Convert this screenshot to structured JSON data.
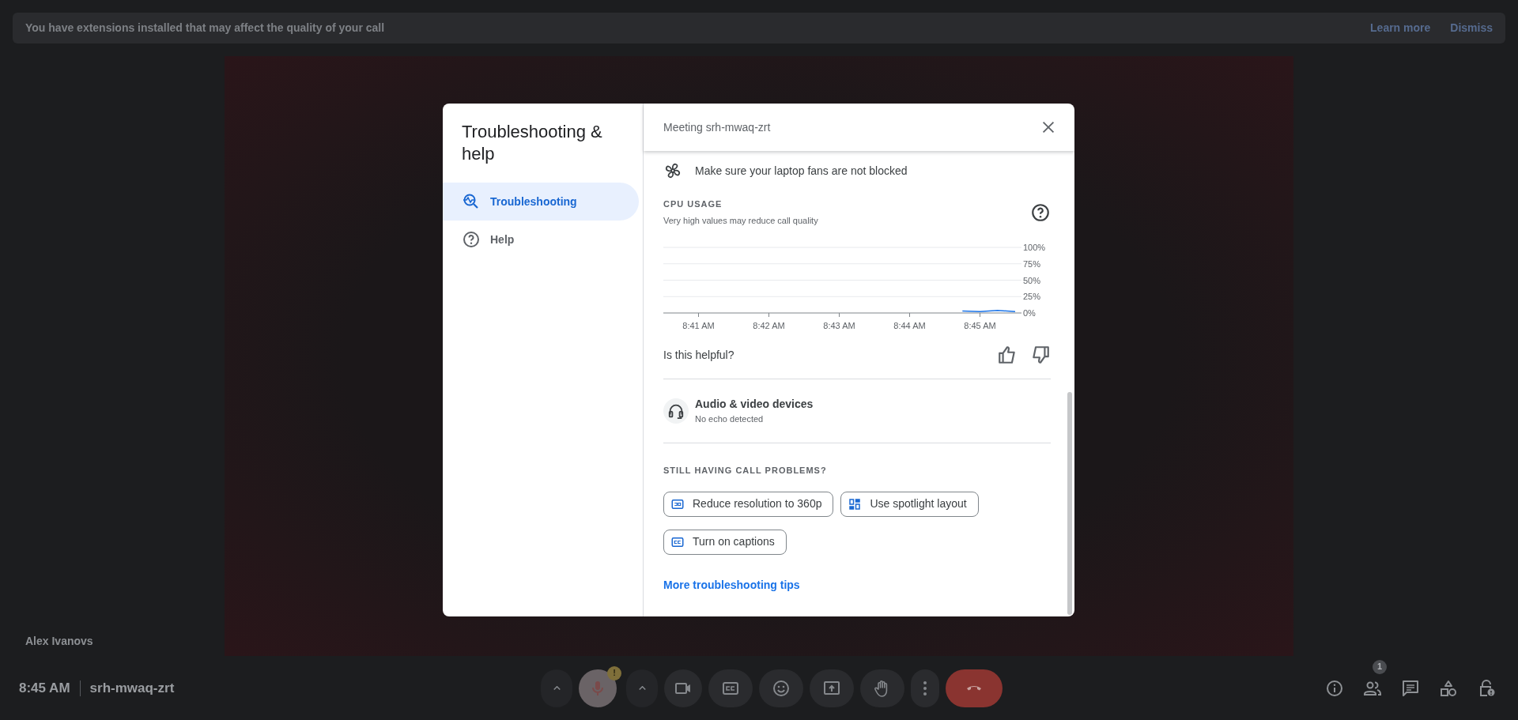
{
  "banner": {
    "text": "You have extensions installed that may affect the quality of your call",
    "links": [
      "Learn more",
      "Dismiss"
    ]
  },
  "tile": {
    "participant_name": "Alex Ivanovs"
  },
  "dialog": {
    "title": "Troubleshooting & help",
    "nav": [
      {
        "label": "Troubleshooting",
        "kind": "troubleshoot",
        "selected": true
      },
      {
        "label": "Help",
        "kind": "help",
        "selected": false
      }
    ],
    "header": {
      "meeting": "Meeting srh-mwaq-zrt"
    },
    "tip": {
      "text": "Make sure your laptop fans are not blocked"
    },
    "cpu": {
      "title": "CPU USAGE",
      "subtitle": "Very high values may reduce call quality",
      "chart_data": {
        "type": "line",
        "grid": true,
        "ylim": [
          0,
          100
        ],
        "categories": [
          null,
          null,
          "8:41 AM",
          null,
          null,
          null,
          "8:42 AM",
          null,
          null,
          null,
          "8:43 AM",
          null,
          null,
          null,
          "8:44 AM",
          null,
          null,
          null,
          "8:45 AM",
          null,
          null
        ],
        "yticks": [
          {
            "value": 0,
            "label": "0%"
          },
          {
            "value": 25,
            "label": "25%"
          },
          {
            "value": 50,
            "label": "50%"
          },
          {
            "value": 75,
            "label": "75%"
          },
          {
            "value": 100,
            "label": "100%"
          }
        ],
        "series": [
          {
            "color": "#1a73e8",
            "values": [
              null,
              null,
              null,
              null,
              null,
              null,
              null,
              null,
              null,
              null,
              null,
              null,
              null,
              null,
              null,
              null,
              null,
              3,
              2,
              4,
              2
            ]
          }
        ]
      }
    },
    "feedback": {
      "question": "Is this helpful?"
    },
    "device_check": {
      "title": "Audio & video devices",
      "status": "No echo detected"
    },
    "problems": {
      "heading": "STILL HAVING CALL PROBLEMS?",
      "actions": [
        {
          "label": "Reduce resolution to 360p",
          "kind": "resolution"
        },
        {
          "label": "Use spotlight layout",
          "kind": "layout"
        },
        {
          "label": "Turn on captions",
          "kind": "captions"
        }
      ]
    },
    "link": "More troubleshooting tips"
  },
  "bottom_bar": {
    "time": "8:45 AM",
    "meeting_code": "srh-mwaq-zrt",
    "controls": [
      {
        "kind": "caret"
      },
      {
        "kind": "mic",
        "badge": "!"
      },
      {
        "kind": "caret"
      },
      {
        "kind": "camera"
      },
      {
        "kind": "captions"
      },
      {
        "kind": "emoji"
      },
      {
        "kind": "present"
      },
      {
        "kind": "hand"
      },
      {
        "kind": "more"
      },
      {
        "kind": "end-call"
      }
    ],
    "side_controls": [
      {
        "kind": "info"
      },
      {
        "kind": "people",
        "badge": "1"
      },
      {
        "kind": "chat"
      },
      {
        "kind": "activities"
      },
      {
        "kind": "lock"
      }
    ]
  }
}
